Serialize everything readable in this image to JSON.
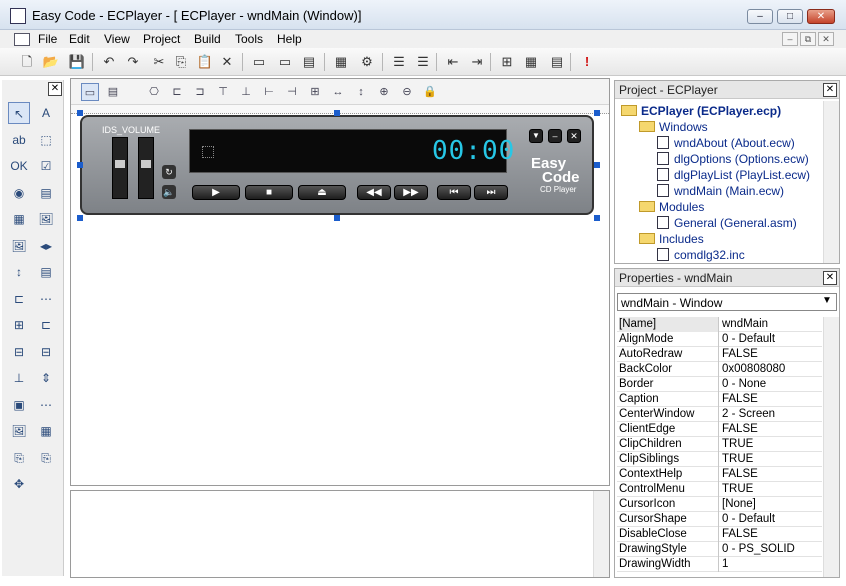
{
  "window": {
    "title": "Easy Code - ECPlayer - [ ECPlayer - wndMain (Window)]",
    "min_glyph": "–",
    "max_glyph": "□",
    "close_glyph": "✕"
  },
  "menu": [
    "File",
    "Edit",
    "View",
    "Project",
    "Build",
    "Tools",
    "Help"
  ],
  "mdi_buttons": [
    "–",
    "⧉",
    "✕"
  ],
  "toolbar_icons": [
    "new-file-icon",
    "open-folder-icon",
    "save-icon",
    "undo-icon",
    "redo-icon",
    "cut-icon",
    "copy-icon",
    "paste-icon",
    "delete-icon",
    "window-icon",
    "dialog-icon",
    "document-icon",
    "resource-icon",
    "settings-icon",
    "indent-icon",
    "outdent-icon",
    "block-indent-icon",
    "block-outdent-icon",
    "run-icon",
    "build-icon",
    "compile-icon",
    "stop-icon"
  ],
  "toolbar_glyphs": [
    "🗋",
    "📂",
    "💾",
    "↶",
    "↷",
    "✂",
    "⎘",
    "📋",
    "✕",
    "▭",
    "▭",
    "▤",
    "▦",
    "⚙",
    "☰",
    "☰",
    "⇤",
    "⇥",
    "⊞",
    "▦",
    "▤",
    "!"
  ],
  "toolbox_glyphs": [
    "↖",
    "A",
    "ab",
    "⬚",
    "OK",
    "☑",
    "◉",
    "▤",
    "▦",
    "🖼",
    "🖼",
    "◂▸",
    "↕",
    "▤",
    "⊏",
    "⋯",
    "⊞",
    "⊏",
    "⊟",
    "⊟",
    "⊥",
    "⇕",
    "▣",
    "⋯",
    "🖼",
    "▦",
    "⎘",
    "⎘",
    "✥"
  ],
  "designer_tool_glyphs": [
    "▭",
    "▤",
    "⎔",
    "⊏",
    "⊐",
    "⊤",
    "⊥",
    "⊢",
    "⊣",
    "⊞",
    "↔",
    "↕",
    "⊕",
    "⊖",
    "🔒"
  ],
  "player": {
    "volume_label": "IDS_VOLUME",
    "time": "00:00",
    "brand_line1": "Easy",
    "brand_line2": "Code",
    "brand_line3": "CD Player",
    "btn_play": "▶",
    "btn_stop": "■",
    "btn_eject": "⏏",
    "btn_rew": "◀◀",
    "btn_ff": "▶▶",
    "btn_prev": "⏮",
    "btn_next": "⏭",
    "top_down": "▼",
    "top_min": "–",
    "top_close": "✕",
    "repeat": "↻",
    "mute": "🔈"
  },
  "project_panel": {
    "title": "Project - ECPlayer",
    "root": "ECPlayer (ECPlayer.ecp)",
    "items": [
      {
        "label": "Windows",
        "kind": "folder",
        "indent": 1
      },
      {
        "label": "wndAbout (About.ecw)",
        "kind": "file",
        "indent": 2
      },
      {
        "label": "dlgOptions (Options.ecw)",
        "kind": "file",
        "indent": 2
      },
      {
        "label": "dlgPlayList (PlayList.ecw)",
        "kind": "file",
        "indent": 2
      },
      {
        "label": "wndMain (Main.ecw)",
        "kind": "file",
        "indent": 2
      },
      {
        "label": "Modules",
        "kind": "folder",
        "indent": 1
      },
      {
        "label": "General (General.asm)",
        "kind": "file",
        "indent": 2
      },
      {
        "label": "Includes",
        "kind": "folder",
        "indent": 1
      },
      {
        "label": "comdlg32.inc",
        "kind": "file",
        "indent": 2
      }
    ]
  },
  "properties_panel": {
    "title": "Properties - wndMain",
    "selector": "wndMain - Window",
    "rows": [
      [
        "[Name]",
        "wndMain"
      ],
      [
        "AlignMode",
        "0 - Default"
      ],
      [
        "AutoRedraw",
        "FALSE"
      ],
      [
        "BackColor",
        "0x00808080"
      ],
      [
        "Border",
        "0 - None"
      ],
      [
        "Caption",
        "FALSE"
      ],
      [
        "CenterWindow",
        "2 - Screen"
      ],
      [
        "ClientEdge",
        "FALSE"
      ],
      [
        "ClipChildren",
        "TRUE"
      ],
      [
        "ClipSiblings",
        "TRUE"
      ],
      [
        "ContextHelp",
        "FALSE"
      ],
      [
        "ControlMenu",
        "TRUE"
      ],
      [
        "CursorIcon",
        "[None]"
      ],
      [
        "CursorShape",
        "0 - Default"
      ],
      [
        "DisableClose",
        "FALSE"
      ],
      [
        "DrawingStyle",
        "0 - PS_SOLID"
      ],
      [
        "DrawingWidth",
        "1"
      ]
    ]
  },
  "colors": {
    "accent": "#1b5dcc",
    "lcd_digits": "#27c7e6",
    "link": "#0a2a8a"
  }
}
